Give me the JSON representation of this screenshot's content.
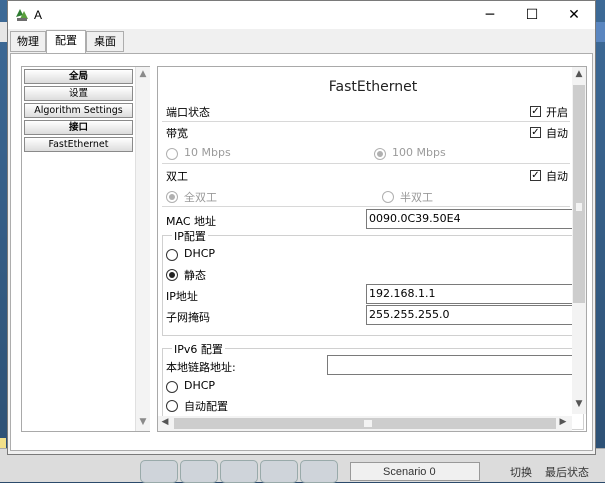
{
  "window": {
    "title": "A",
    "tabs": [
      {
        "label": "物理"
      },
      {
        "label": "配置"
      },
      {
        "label": "桌面"
      }
    ]
  },
  "sidebar": {
    "items": [
      {
        "label": "全局"
      },
      {
        "label": "设置"
      },
      {
        "label": "Algorithm Settings"
      },
      {
        "label": "接口"
      },
      {
        "label": "FastEthernet"
      }
    ]
  },
  "panel": {
    "title": "FastEthernet",
    "port_status": {
      "label": "端口状态",
      "checkbox_label": "开启",
      "checked": true
    },
    "bandwidth": {
      "label": "带宽",
      "auto_label": "自动",
      "auto_checked": true,
      "option_10": "10 Mbps",
      "option_100": "100 Mbps",
      "selected": "100 Mbps"
    },
    "duplex": {
      "label": "双工",
      "auto_label": "自动",
      "auto_checked": true,
      "full": "全双工",
      "half": "半双工",
      "selected": "全双工"
    },
    "mac": {
      "label": "MAC 地址",
      "value": "0090.0C39.50E4"
    },
    "ip_config": {
      "group_title": "IP配置",
      "dhcp": "DHCP",
      "static": "静态",
      "selected": "静态",
      "ip_label": "IP地址",
      "ip_value": "192.168.1.1",
      "mask_label": "子网掩码",
      "mask_value": "255.255.255.0"
    },
    "ipv6_config": {
      "group_title": "IPv6 配置",
      "link_local_label": "本地链路地址:",
      "link_local_value": "",
      "dhcp": "DHCP",
      "auto": "自动配置"
    }
  },
  "background": {
    "scenario": "Scenario 0",
    "text_1": "切换",
    "text_2": "最后状态"
  }
}
